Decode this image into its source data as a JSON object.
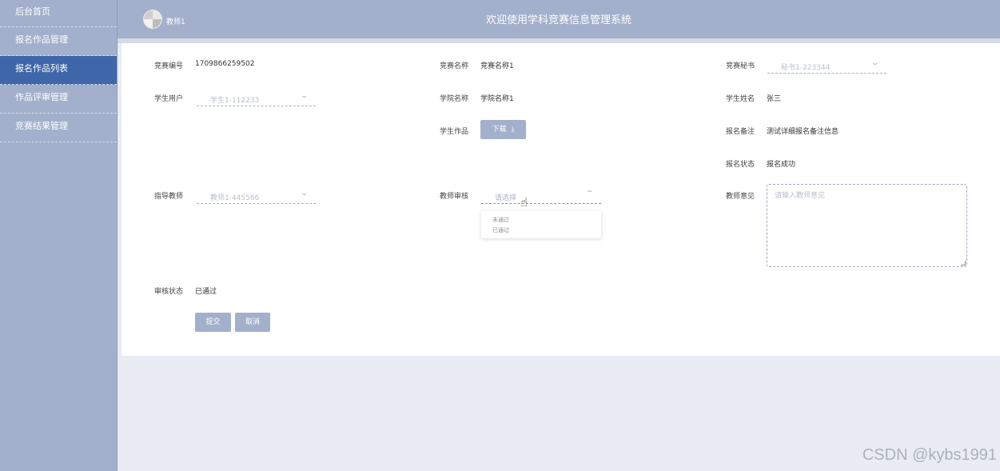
{
  "sidebar": {
    "items": [
      {
        "label": "后台首页"
      },
      {
        "label": "报名作品管理"
      },
      {
        "label": "报名作品列表"
      },
      {
        "label": "作品评审管理"
      },
      {
        "label": "竞赛结果管理"
      }
    ],
    "active_index": 2
  },
  "header": {
    "user": "教师1",
    "title": "欢迎使用学科竞赛信息管理系统"
  },
  "form": {
    "contest_no": {
      "label": "竞赛编号",
      "value": "1709866259502"
    },
    "contest_name": {
      "label": "竞赛名称",
      "value": "竞赛名称1"
    },
    "contest_secretary": {
      "label": "竞赛秘书",
      "value": "秘书1-223344"
    },
    "student_user": {
      "label": "学生用户",
      "value": "学生1-112233"
    },
    "college_name": {
      "label": "学院名称",
      "value": "学院名称1"
    },
    "student_name": {
      "label": "学生姓名",
      "value": "张三"
    },
    "student_work": {
      "label": "学生作品",
      "button": "下载"
    },
    "remark": {
      "label": "报名备注",
      "value": "测试详细报名备注信息"
    },
    "reg_status": {
      "label": "报名状态",
      "value": "报名成功"
    },
    "advisor": {
      "label": "指导教师",
      "value": "教师1-445566"
    },
    "teacher_review": {
      "label": "教师审核",
      "placeholder": "请选择",
      "options": [
        "未通过",
        "已通过"
      ]
    },
    "teacher_opinion": {
      "label": "教师意见",
      "placeholder": "请输入教师意见"
    },
    "review_status": {
      "label": "审核状态",
      "value": "已通过"
    },
    "submit_label": "提交",
    "cancel_label": "取消"
  },
  "watermark": "CSDN @kybs1991",
  "colors": {
    "sidebar": "#a2b0cb",
    "sidebar_active": "#3e66a9",
    "button": "#a2b0cb",
    "background": "#e9ecf2"
  }
}
